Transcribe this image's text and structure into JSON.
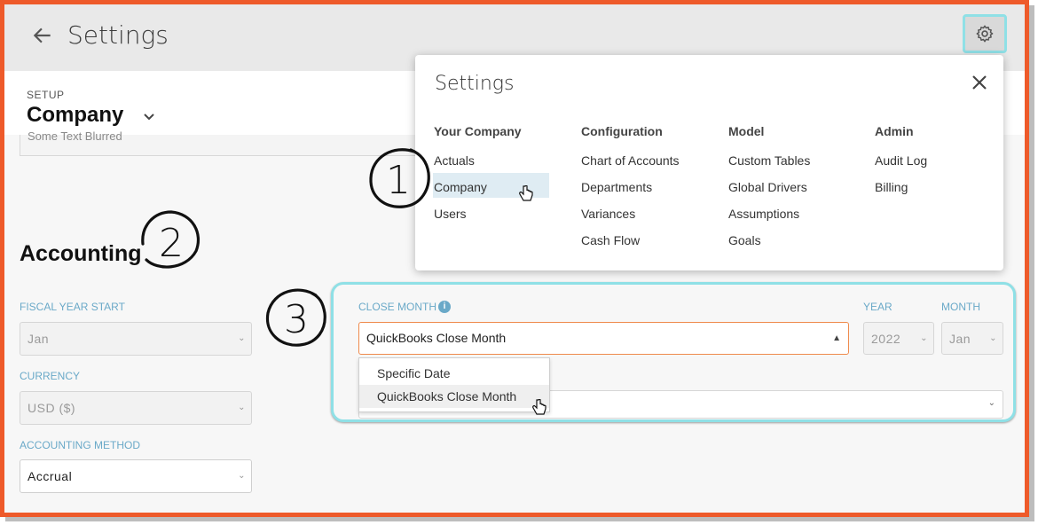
{
  "header": {
    "title": "Settings",
    "back_icon": "arrow-left-icon",
    "settings_icon": "gear-icon"
  },
  "setup": {
    "eyebrow": "SETUP",
    "page": "Company"
  },
  "remnant_field": {
    "value": "Some Text Blurred"
  },
  "accounting": {
    "heading": "Accounting",
    "fiscal_year_start": {
      "label": "FISCAL YEAR START",
      "value": "Jan"
    },
    "currency": {
      "label": "CURRENCY",
      "value": "USD ($)"
    },
    "method": {
      "label": "ACCOUNTING METHOD",
      "value": "Accrual"
    }
  },
  "close_month": {
    "label": "CLOSE MONTH",
    "value": "QuickBooks Close Month",
    "year_label": "YEAR",
    "year_value": "2022",
    "month_label": "MONTH",
    "month_value": "Jan",
    "options": [
      "Specific Date",
      "QuickBooks Close Month"
    ]
  },
  "settings_popup": {
    "title": "Settings",
    "columns": [
      {
        "heading": "Your Company",
        "items": [
          "Actuals",
          "Company",
          "Users"
        ]
      },
      {
        "heading": "Configuration",
        "items": [
          "Chart of Accounts",
          "Departments",
          "Variances",
          "Cash Flow"
        ]
      },
      {
        "heading": "Model",
        "items": [
          "Custom Tables",
          "Global Drivers",
          "Assumptions",
          "Goals"
        ]
      },
      {
        "heading": "Admin",
        "items": [
          "Audit Log",
          "Billing"
        ]
      }
    ],
    "highlighted": "Company"
  },
  "annotations": [
    "1",
    "2",
    "3"
  ],
  "colors": {
    "frame": "#ee5a2a",
    "accent_label": "#6aa9c8",
    "callout": "#8fe0e6",
    "focus": "#ef8a4c"
  }
}
